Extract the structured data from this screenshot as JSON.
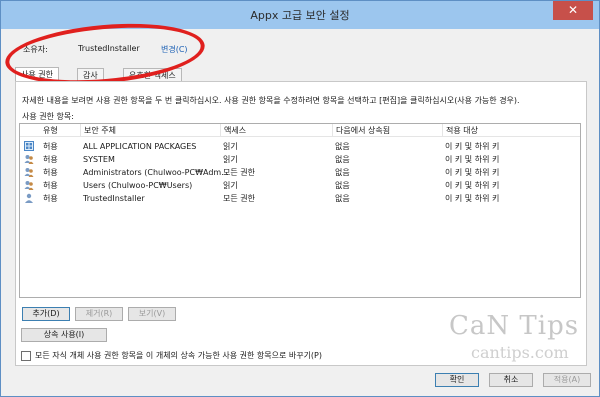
{
  "window": {
    "title": "Appx 고급 보안 설정",
    "close_label": "✕"
  },
  "owner": {
    "label": "소유자:",
    "value": "TrustedInstaller",
    "change_link": "변경(C)"
  },
  "tabs": [
    {
      "label": "사용 권한",
      "active": true
    },
    {
      "label": "감사",
      "active": false
    },
    {
      "label": "유효한 액세스",
      "active": false
    }
  ],
  "panel": {
    "instructions": "자세한 내용을 보려면 사용 권한 항목을 두 번 클릭하십시오. 사용 권한 항목을 수정하려면 항목을 선택하고 [편집]을 클릭하십시오(사용 가능한 경우).",
    "entries_label": "사용 권한 항목:"
  },
  "list": {
    "columns": [
      "유형",
      "보안 주체",
      "액세스",
      "다음에서 상속됨",
      "적용 대상"
    ],
    "rows": [
      {
        "type": "허용",
        "principal": "ALL APPLICATION PACKAGES",
        "access": "읽기",
        "inherited": "없음",
        "applies": "이 키 및 하위 키"
      },
      {
        "type": "허용",
        "principal": "SYSTEM",
        "access": "읽기",
        "inherited": "없음",
        "applies": "이 키 및 하위 키"
      },
      {
        "type": "허용",
        "principal": "Administrators (Chulwoo-PC₩Adm...",
        "access": "모든 권한",
        "inherited": "없음",
        "applies": "이 키 및 하위 키"
      },
      {
        "type": "허용",
        "principal": "Users (Chulwoo-PC₩Users)",
        "access": "읽기",
        "inherited": "없음",
        "applies": "이 키 및 하위 키"
      },
      {
        "type": "허용",
        "principal": "TrustedInstaller",
        "access": "모든 권한",
        "inherited": "없음",
        "applies": "이 키 및 하위 키"
      }
    ]
  },
  "buttons": {
    "add": "추가(D)",
    "remove": "제거(R)",
    "view": "보기(V)",
    "inherit": "상속 사용(I)",
    "replace_checkbox": "모든 자식 개체 사용 권한 항목을 이 개체의 상속 가능한 사용 권한 항목으로 바꾸기(P)",
    "ok": "확인",
    "cancel": "취소",
    "apply": "적용(A)"
  },
  "watermark": {
    "line1": "CaN Tips",
    "line2": "cantips.com"
  },
  "colors": {
    "accent": "#1a5fb4",
    "title_bar": "#9cc6ee",
    "close": "#c7504a",
    "highlight": "#e0201e"
  }
}
